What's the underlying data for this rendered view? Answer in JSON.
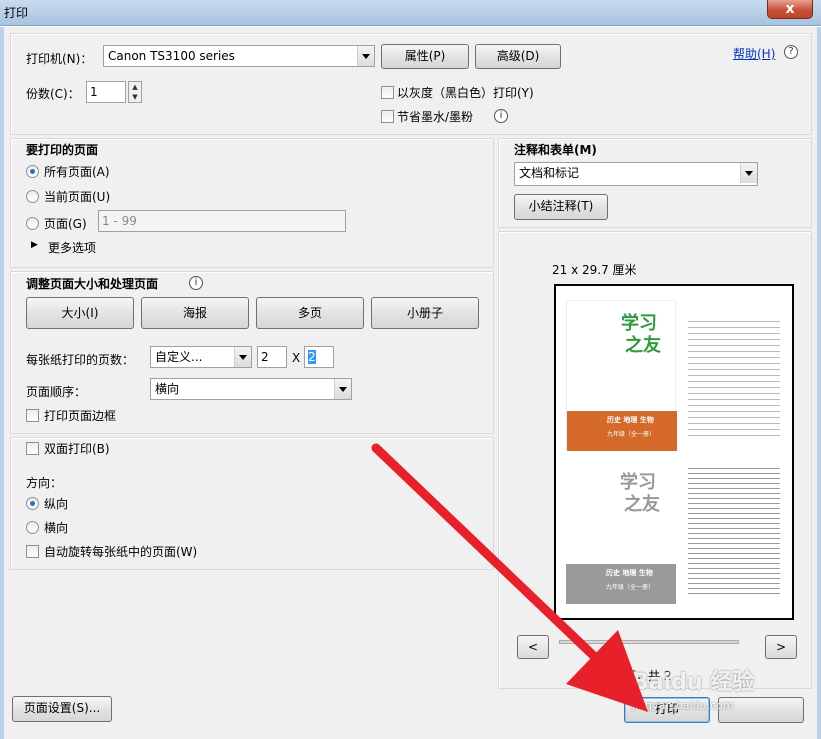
{
  "window": {
    "title": "打印",
    "close_label": "x"
  },
  "printer": {
    "label": "打印机(N)：",
    "selected": "Canon TS3100 series",
    "properties_btn": "属性(P)",
    "advanced_btn": "高级(D)",
    "help_link": "帮助(H)",
    "copies_label": "份数(C)：",
    "copies_value": "1",
    "grayscale_label": "以灰度（黑白色）打印(Y)",
    "save_ink_label": "节省墨水/墨粉"
  },
  "pages": {
    "heading": "要打印的页面",
    "all_pages": "所有页面(A)",
    "current_page": "当前页面(U)",
    "pages_label": "页面(G)",
    "pages_placeholder": "1 - 99",
    "more_options": "更多选项"
  },
  "sizing": {
    "heading": "调整页面大小和处理页面",
    "size_btn": "大小(I)",
    "poster_btn": "海报",
    "multiple_btn": "多页",
    "booklet_btn": "小册子",
    "pages_per_sheet_label": "每张纸打印的页数：",
    "pages_per_sheet_value": "自定义...",
    "cols": "2",
    "x_sep": "X",
    "rows": "2",
    "page_order_label": "页面顺序：",
    "page_order_value": "横向",
    "print_border_label": "打印页面边框"
  },
  "duplex": {
    "duplex_label": "双面打印(B)",
    "orientation_label": "方向：",
    "portrait": "纵向",
    "landscape": "横向",
    "auto_rotate": "自动旋转每张纸中的页面(W)"
  },
  "comments": {
    "heading": "注释和表单(M)",
    "selected": "文档和标记",
    "summarize_btn": "小结注释(T)"
  },
  "preview": {
    "size_text": "21 x 29.7 厘米",
    "page_text": "页，共 2",
    "book1": {
      "title1": "学习",
      "title2": "之友",
      "subject": "历史 地理 生物",
      "grade": "九年级（全一册）"
    },
    "book2": {
      "title1": "学习",
      "title2": "之友",
      "subject": "历史 地理 生物",
      "grade": "九年级（全一册）"
    },
    "prev_label": "<",
    "next_label": ">"
  },
  "footer": {
    "page_setup_btn": "页面设置(S)...",
    "print_btn": "打印",
    "watermark": "Baidu 经验",
    "watermark_url": "jingyan.baidu.com"
  },
  "colors": {
    "accent": "#2c6fb6",
    "arrow": "#e8202a"
  }
}
